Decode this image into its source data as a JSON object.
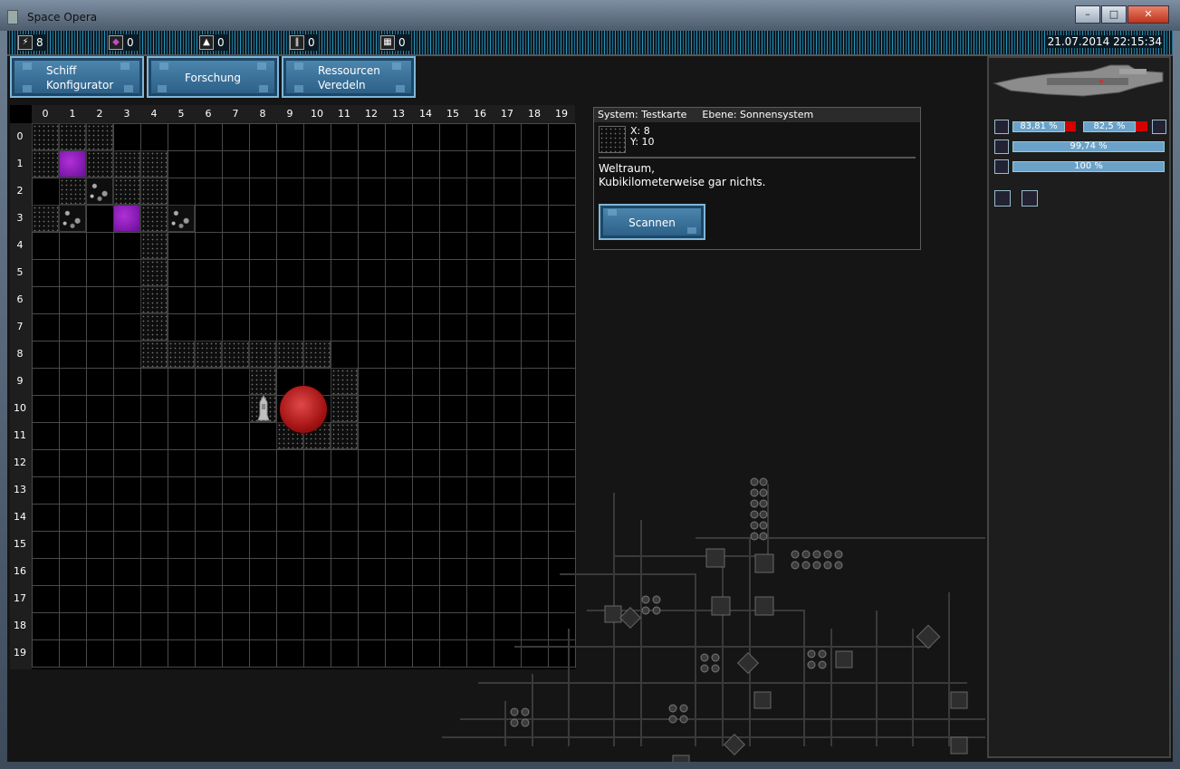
{
  "window": {
    "title": "Space Opera",
    "minimize": "–",
    "maximize": "□",
    "close": "✕"
  },
  "resources": [
    {
      "icon": "energy-icon",
      "glyph": "⚡",
      "value": "8"
    },
    {
      "icon": "crystal-icon",
      "glyph": "◆",
      "value": "0"
    },
    {
      "icon": "ore-icon",
      "glyph": "▲",
      "value": "0"
    },
    {
      "icon": "gas-icon",
      "glyph": "‖",
      "value": "0"
    },
    {
      "icon": "components-icon",
      "glyph": "▦",
      "value": "0"
    }
  ],
  "datetime": "21.07.2014 22:15:34",
  "nav": [
    {
      "line1": "Schiff",
      "line2": "Konfigurator"
    },
    {
      "line1": "Forschung",
      "line2": ""
    },
    {
      "line1": "Ressourcen",
      "line2": "Veredeln"
    }
  ],
  "map": {
    "columns": [
      "0",
      "1",
      "2",
      "3",
      "4",
      "5",
      "6",
      "7",
      "8",
      "9",
      "10",
      "11",
      "12",
      "13",
      "14",
      "15",
      "16",
      "17",
      "18",
      "19"
    ],
    "rows": [
      "0",
      "1",
      "2",
      "3",
      "4",
      "5",
      "6",
      "7",
      "8",
      "9",
      "10",
      "11",
      "12",
      "13",
      "14",
      "15",
      "16",
      "17",
      "18",
      "19"
    ],
    "dust": [
      [
        0,
        0
      ],
      [
        1,
        0
      ],
      [
        2,
        0
      ],
      [
        0,
        1
      ],
      [
        2,
        1
      ],
      [
        3,
        1
      ],
      [
        4,
        1
      ],
      [
        1,
        2
      ],
      [
        3,
        2
      ],
      [
        0,
        3
      ],
      [
        4,
        2
      ],
      [
        4,
        3
      ],
      [
        4,
        4
      ],
      [
        4,
        5
      ],
      [
        4,
        6
      ],
      [
        4,
        7
      ],
      [
        4,
        8
      ],
      [
        5,
        8
      ],
      [
        6,
        8
      ],
      [
        7,
        8
      ],
      [
        8,
        8
      ],
      [
        9,
        8
      ],
      [
        10,
        8
      ],
      [
        8,
        9
      ],
      [
        11,
        9
      ],
      [
        8,
        10
      ],
      [
        11,
        10
      ],
      [
        9,
        11
      ],
      [
        10,
        11
      ],
      [
        11,
        11
      ]
    ],
    "asteroids": [
      [
        2,
        2
      ],
      [
        4,
        2
      ],
      [
        1,
        3
      ],
      [
        4,
        3
      ],
      [
        5,
        3
      ]
    ],
    "nebula": [
      [
        1,
        1
      ],
      [
        3,
        3
      ]
    ],
    "planet": [
      9,
      10
    ],
    "ship": [
      8,
      10
    ]
  },
  "info": {
    "system_label": "System: Testkarte",
    "level_label": "Ebene: Sonnensystem",
    "x": "X:  8",
    "y": "Y:  10",
    "desc1": "Weltraum,",
    "desc2": "Kubikilometerweise gar nichts.",
    "scan_label": "Scannen"
  },
  "ship_status": {
    "hull_text": "83,81 %",
    "hull_value": 83.81,
    "shield_text": "82,5 %",
    "shield_value": 82.5,
    "cargo_text": "99,74 %",
    "cargo_value": 99.74,
    "fuel_text": "100 %",
    "fuel_value": 100
  },
  "colors": {
    "accent": "#2a5d86",
    "bar": "#6aa2c9",
    "warn": "#d40000",
    "nebula": "#9b1fd0",
    "planet": "#c62020"
  }
}
